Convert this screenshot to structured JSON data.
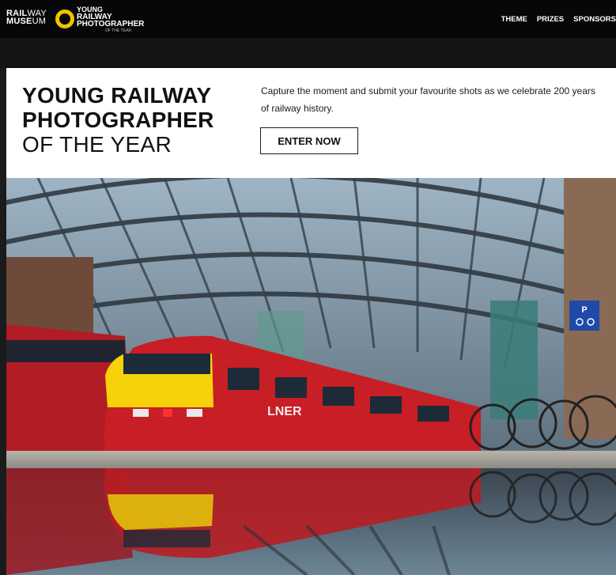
{
  "header": {
    "railway_museum_logo": {
      "line1_bold": "RAIL",
      "line1_thin": "WAY",
      "line2_bold": "MUSE",
      "line2_thin": "UM"
    },
    "competition_logo": {
      "line1": "YOUNG",
      "line2": "RAILWAY",
      "line3": "PHOTOGRAPHER",
      "line4": "OF THE YEAR"
    },
    "nav": [
      "THEME",
      "PRIZES",
      "SPONSORS"
    ]
  },
  "hero": {
    "title_line1": "YOUNG RAILWAY",
    "title_line2": "PHOTOGRAPHER",
    "title_line3": "OF THE YEAR",
    "description": "Capture the moment and submit your favourite shots as we celebrate 200 years of railway history.",
    "cta_label": "ENTER NOW",
    "photo": {
      "train_brand": "LNER",
      "platform_sign": "P"
    }
  },
  "colors": {
    "topbar": "#070707",
    "logo_ring": "#f2c300",
    "train_red": "#c81e25",
    "train_yellow": "#f5d20a",
    "sign_blue": "#1f4aa8"
  }
}
